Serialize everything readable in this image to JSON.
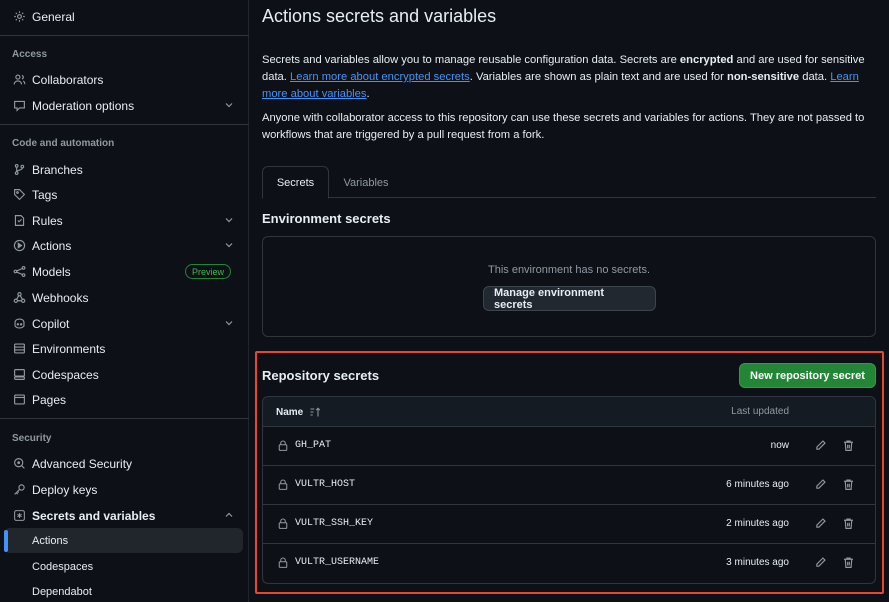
{
  "sidebar": {
    "general": "General",
    "sections": {
      "access": "Access",
      "code_automation": "Code and automation",
      "security": "Security"
    },
    "items": {
      "collaborators": "Collaborators",
      "moderation": "Moderation options",
      "branches": "Branches",
      "tags": "Tags",
      "rules": "Rules",
      "actions": "Actions",
      "models": "Models",
      "models_badge": "Preview",
      "webhooks": "Webhooks",
      "copilot": "Copilot",
      "environments": "Environments",
      "codespaces": "Codespaces",
      "pages": "Pages",
      "advanced_security": "Advanced Security",
      "deploy_keys": "Deploy keys",
      "secrets_variables": "Secrets and variables"
    },
    "sub_items": {
      "actions": "Actions",
      "codespaces": "Codespaces",
      "dependabot": "Dependabot"
    }
  },
  "page": {
    "title": "Actions secrets and variables",
    "intro": {
      "t1": "Secrets and variables allow you to manage reusable configuration data. Secrets are ",
      "b1": "encrypted",
      "t2": " and are used for sensitive data. ",
      "link1": "Learn more about encrypted secrets",
      "t3": ". Variables are shown as plain text and are used for ",
      "b2": "non-sensitive",
      "t4": " data. ",
      "link2": "Learn more about variables",
      "t5": "."
    },
    "access_note": "Anyone with collaborator access to this repository can use these secrets and variables for actions. They are not passed to workflows that are triggered by a pull request from a fork.",
    "tabs": [
      "Secrets",
      "Variables"
    ],
    "env_heading": "Environment secrets",
    "env_empty": "This environment has no secrets.",
    "env_button": "Manage environment secrets",
    "repo_heading": "Repository secrets",
    "repo_button": "New repository secret",
    "table": {
      "col_name": "Name",
      "col_updated": "Last updated",
      "rows": [
        {
          "name": "GH_PAT",
          "updated": "now"
        },
        {
          "name": "VULTR_HOST",
          "updated": "6 minutes ago"
        },
        {
          "name": "VULTR_SSH_KEY",
          "updated": "2 minutes ago"
        },
        {
          "name": "VULTR_USERNAME",
          "updated": "3 minutes ago"
        }
      ]
    }
  },
  "colors": {
    "background": "#0d1117",
    "border": "#30363d",
    "link": "#4493f8",
    "primary_button": "#238636",
    "highlight": "#e5482b"
  }
}
